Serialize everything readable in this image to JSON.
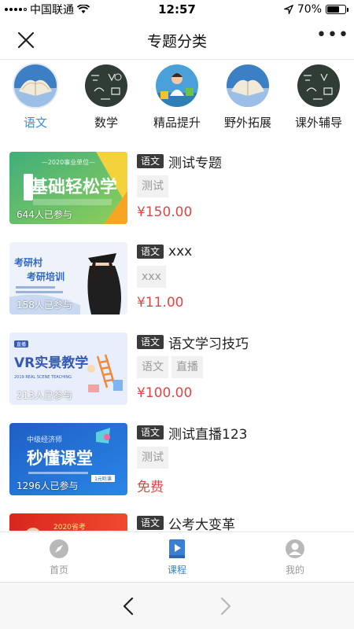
{
  "status_bar": {
    "carrier": "中国联通",
    "time": "12:57",
    "battery": "70%",
    "battery_level": 0.7
  },
  "nav": {
    "title": "专题分类",
    "more_label": "•••"
  },
  "categories": [
    {
      "label": "语文",
      "icon": "book-icon",
      "active": true
    },
    {
      "label": "数学",
      "icon": "chalkboard-icon",
      "active": false
    },
    {
      "label": "精品提升",
      "icon": "student-icon",
      "active": false
    },
    {
      "label": "野外拓展",
      "icon": "book-icon",
      "active": false
    },
    {
      "label": "课外辅导",
      "icon": "chalkboard-icon",
      "active": false
    }
  ],
  "courses": [
    {
      "tag": "语文",
      "title": "测试专题",
      "chips": [
        "测试"
      ],
      "price": "¥150.00",
      "participants": "644人已参与",
      "thumb_text": "基础轻松学",
      "thumb_top_text": "—2020事业单位—",
      "thumb_colors": [
        "#3fae7a",
        "#f4d23c"
      ]
    },
    {
      "tag": "语文",
      "title": "xxx",
      "chips": [
        "xxx"
      ],
      "price": "¥11.00",
      "participants": "158人已参与",
      "thumb_text": "考研村",
      "thumb_sub_text": "考研培训",
      "thumb_colors": [
        "#eaf0fa",
        "#2f67c9"
      ]
    },
    {
      "tag": "语文",
      "title": "语文学习技巧",
      "chips": [
        "语文",
        "直播"
      ],
      "price": "¥100.00",
      "participants": "213人已参与",
      "thumb_text": "VR实景教学",
      "thumb_top_text": "直播",
      "thumb_sub_text": "2019 REAL SCENE TEACHING",
      "thumb_colors": [
        "#e6ecfb",
        "#3559b8"
      ]
    },
    {
      "tag": "语文",
      "title": "测试直播123",
      "chips": [
        "测试"
      ],
      "price": "免费",
      "participants": "1296人已参与",
      "thumb_text": "秒懂课堂",
      "thumb_top_text": "中级经济师",
      "thumb_sub_text": "1元听课",
      "thumb_colors": [
        "#1f5fc4",
        "#2a86e8"
      ]
    },
    {
      "tag": "语文",
      "title": "公考大变革",
      "chips": [],
      "price": "",
      "participants": "",
      "thumb_text": "2020省考",
      "thumb_colors": [
        "#d8261e",
        "#f04a2e"
      ]
    }
  ],
  "tabs": [
    {
      "label": "首页",
      "icon": "compass-icon",
      "active": false
    },
    {
      "label": "课程",
      "icon": "book-open-icon",
      "active": true
    },
    {
      "label": "我的",
      "icon": "user-icon",
      "active": false
    }
  ],
  "colors": {
    "accent": "#3a8ee6",
    "price": "#e04646",
    "tag_bg": "#3a3a3a",
    "chip_bg": "#f1f1f1"
  }
}
